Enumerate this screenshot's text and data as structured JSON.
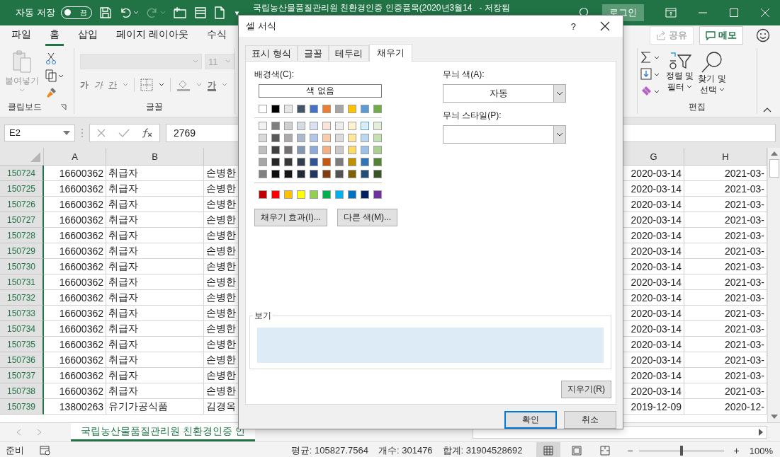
{
  "title_bar": {
    "autosave_label": "자동 저장",
    "autosave_toggle": {
      "label": "끔",
      "on": false
    },
    "customize": "▾",
    "document_title": "국립농산물품질관리원 친환경인증 인증품목(2020년3월14",
    "save_status": "- 저장됨",
    "login_button": "로그인"
  },
  "ribbon_tabs": [
    {
      "label": "파일",
      "selected": false
    },
    {
      "label": "홈",
      "selected": true
    },
    {
      "label": "삽입",
      "selected": false
    },
    {
      "label": "페이지 레이아웃",
      "selected": false
    },
    {
      "label": "수식",
      "selected": false
    }
  ],
  "share_button": {
    "label": "공유",
    "disabled": true
  },
  "memo_button": {
    "label": "메모"
  },
  "clipboard_group": {
    "label": "클립보드",
    "paste": {
      "label": "붙여넣기",
      "disabled": true
    }
  },
  "font_group": {
    "label": "글꼴",
    "font_size": "11",
    "bold": "가",
    "italic": "가",
    "underline": "간",
    "font_color": "가"
  },
  "editing_group": {
    "label": "편집",
    "sort_filter": [
      "정렬 및",
      "필터"
    ],
    "find_select": [
      "찾기 및",
      "선택"
    ]
  },
  "formula_bar": {
    "name_box": "E2",
    "value": "2769"
  },
  "columns": [
    "A",
    "B",
    "G",
    "H"
  ],
  "rows": [
    {
      "number": "150724",
      "cells": [
        "16600362",
        "취급자",
        "손병한",
        "2020-03-14",
        "2021-03-"
      ]
    },
    {
      "number": "150725",
      "cells": [
        "16600362",
        "취급자",
        "손병한",
        "2020-03-14",
        "2021-03-"
      ]
    },
    {
      "number": "150726",
      "cells": [
        "16600362",
        "취급자",
        "손병한",
        "2020-03-14",
        "2021-03-"
      ]
    },
    {
      "number": "150727",
      "cells": [
        "16600362",
        "취급자",
        "손병한",
        "2020-03-14",
        "2021-03-"
      ]
    },
    {
      "number": "150728",
      "cells": [
        "16600362",
        "취급자",
        "손병한",
        "2020-03-14",
        "2021-03-"
      ]
    },
    {
      "number": "150729",
      "cells": [
        "16600362",
        "취급자",
        "손병한",
        "2020-03-14",
        "2021-03-"
      ]
    },
    {
      "number": "150730",
      "cells": [
        "16600362",
        "취급자",
        "손병한",
        "2020-03-14",
        "2021-03-"
      ]
    },
    {
      "number": "150731",
      "cells": [
        "16600362",
        "취급자",
        "손병한",
        "2020-03-14",
        "2021-03-"
      ]
    },
    {
      "number": "150732",
      "cells": [
        "16600362",
        "취급자",
        "손병한",
        "2020-03-14",
        "2021-03-"
      ]
    },
    {
      "number": "150733",
      "cells": [
        "16600362",
        "취급자",
        "손병한",
        "2020-03-14",
        "2021-03-"
      ]
    },
    {
      "number": "150734",
      "cells": [
        "16600362",
        "취급자",
        "손병한",
        "2020-03-14",
        "2021-03-"
      ]
    },
    {
      "number": "150735",
      "cells": [
        "16600362",
        "취급자",
        "손병한",
        "2020-03-14",
        "2021-03-"
      ]
    },
    {
      "number": "150736",
      "cells": [
        "16600362",
        "취급자",
        "손병한",
        "2020-03-14",
        "2021-03-"
      ]
    },
    {
      "number": "150737",
      "cells": [
        "16600362",
        "취급자",
        "손병한",
        "2020-03-14",
        "2021-03-"
      ]
    },
    {
      "number": "150738",
      "cells": [
        "16600362",
        "취급자",
        "손병한",
        "2020-03-14",
        "2021-03-"
      ]
    },
    {
      "number": "150739",
      "cells": [
        "13800263",
        "유기가공식품",
        "김경옥",
        "2019-12-09",
        "2020-12-"
      ]
    }
  ],
  "sheet_tabs": [
    {
      "label": "국립농산물품질관리원 친환경인증 인",
      "selected": true
    }
  ],
  "status_bar": {
    "ready": "준비",
    "average": "평균: 105827.7564",
    "count": "개수: 301476",
    "sum": "합계: 31904528692",
    "views": [
      {
        "kind": "normal",
        "selected": true
      },
      {
        "kind": "page_layout",
        "selected": false
      },
      {
        "kind": "page_break",
        "selected": false
      }
    ],
    "zoom": {
      "minus": "−",
      "plus": "+",
      "level": 0.5,
      "reading": "100%"
    }
  },
  "dialog": {
    "title": "셀 서식",
    "help": "?",
    "tabs": [
      {
        "label": "표시 형식",
        "selected": false
      },
      {
        "label": "글꼴",
        "selected": false
      },
      {
        "label": "테두리",
        "selected": false
      },
      {
        "label": "채우기",
        "selected": true
      }
    ],
    "fill": {
      "background_label": "배경색(C):",
      "no_color_button": "색 없음",
      "theme_row": [
        {
          "color": "#ffffff",
          "selected": false
        },
        {
          "color": "#000000",
          "selected": false
        },
        {
          "color": "#e7e6e6",
          "selected": false
        },
        {
          "color": "#44546a",
          "selected": false
        },
        {
          "color": "#4472c4",
          "selected": false
        },
        {
          "color": "#ed7d31",
          "selected": false
        },
        {
          "color": "#a5a5a5",
          "selected": false
        },
        {
          "color": "#ffc000",
          "selected": false
        },
        {
          "color": "#5b9bd5",
          "selected": false
        },
        {
          "color": "#70ad47",
          "selected": false
        }
      ],
      "shade_rows": [
        [
          {
            "color": "#f2f2f2",
            "selected": false
          },
          {
            "color": "#7f7f7f",
            "selected": false
          },
          {
            "color": "#d0cece",
            "selected": false
          },
          {
            "color": "#d6dce4",
            "selected": false
          },
          {
            "color": "#d9e1f2",
            "selected": false
          },
          {
            "color": "#fce4d6",
            "selected": false
          },
          {
            "color": "#ededed",
            "selected": false
          },
          {
            "color": "#fff2cc",
            "selected": false
          },
          {
            "color": "#ddebf7",
            "selected": true
          },
          {
            "color": "#e2efda",
            "selected": false
          }
        ],
        [
          {
            "color": "#d9d9d9",
            "selected": false
          },
          {
            "color": "#595959",
            "selected": false
          },
          {
            "color": "#aeaaaa",
            "selected": false
          },
          {
            "color": "#acb9ca",
            "selected": false
          },
          {
            "color": "#b4c6e7",
            "selected": false
          },
          {
            "color": "#f8cbad",
            "selected": false
          },
          {
            "color": "#dbdbdb",
            "selected": false
          },
          {
            "color": "#ffe699",
            "selected": false
          },
          {
            "color": "#bdd7ee",
            "selected": false
          },
          {
            "color": "#c6e0b4",
            "selected": false
          }
        ],
        [
          {
            "color": "#bfbfbf",
            "selected": false
          },
          {
            "color": "#404040",
            "selected": false
          },
          {
            "color": "#757171",
            "selected": false
          },
          {
            "color": "#8497b0",
            "selected": false
          },
          {
            "color": "#8ea9db",
            "selected": false
          },
          {
            "color": "#f4b084",
            "selected": false
          },
          {
            "color": "#c9c9c9",
            "selected": false
          },
          {
            "color": "#ffd966",
            "selected": false
          },
          {
            "color": "#9bc2e6",
            "selected": false
          },
          {
            "color": "#a9d08e",
            "selected": false
          }
        ],
        [
          {
            "color": "#a6a6a6",
            "selected": false
          },
          {
            "color": "#262626",
            "selected": false
          },
          {
            "color": "#3a3838",
            "selected": false
          },
          {
            "color": "#333f4f",
            "selected": false
          },
          {
            "color": "#305496",
            "selected": false
          },
          {
            "color": "#c65911",
            "selected": false
          },
          {
            "color": "#7b7b7b",
            "selected": false
          },
          {
            "color": "#bf8f00",
            "selected": false
          },
          {
            "color": "#2f75b5",
            "selected": false
          },
          {
            "color": "#548235",
            "selected": false
          }
        ],
        [
          {
            "color": "#808080",
            "selected": false
          },
          {
            "color": "#0d0d0d",
            "selected": false
          },
          {
            "color": "#161616",
            "selected": false
          },
          {
            "color": "#222b35",
            "selected": false
          },
          {
            "color": "#203764",
            "selected": false
          },
          {
            "color": "#833c0c",
            "selected": false
          },
          {
            "color": "#525252",
            "selected": false
          },
          {
            "color": "#806000",
            "selected": false
          },
          {
            "color": "#1f4e78",
            "selected": false
          },
          {
            "color": "#375623",
            "selected": false
          }
        ]
      ],
      "standard_row": [
        {
          "color": "#c00000",
          "selected": false
        },
        {
          "color": "#ff0000",
          "selected": false
        },
        {
          "color": "#ffc000",
          "selected": false
        },
        {
          "color": "#ffff00",
          "selected": false
        },
        {
          "color": "#92d050",
          "selected": false
        },
        {
          "color": "#00b050",
          "selected": false
        },
        {
          "color": "#00b0f0",
          "selected": false
        },
        {
          "color": "#0070c0",
          "selected": false
        },
        {
          "color": "#002060",
          "selected": false
        },
        {
          "color": "#7030a0",
          "selected": false
        }
      ],
      "effects_button": "채우기 효과(I)...",
      "more_colors_button": "다른 색(M)...",
      "pattern_color_label": "무늬 색(A):",
      "pattern_color": "자동",
      "pattern_style_label": "무늬 스타일(P):",
      "sample_label": "보기",
      "clear_button": "지우기(R)"
    },
    "ok_button": "확인",
    "cancel_button": "취소"
  }
}
